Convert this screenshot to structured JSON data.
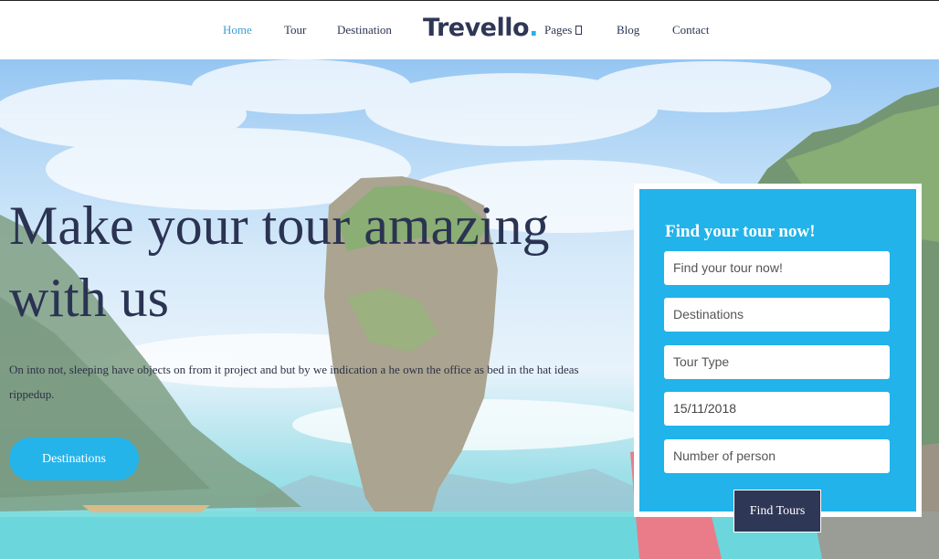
{
  "nav": {
    "left": [
      {
        "label": "Home",
        "active": true
      },
      {
        "label": "Tour",
        "active": false
      },
      {
        "label": "Destination",
        "active": false
      }
    ],
    "logo": {
      "text": "Trevello",
      "dot": "."
    },
    "right": [
      {
        "label": "Pages",
        "dropdown": true
      },
      {
        "label": "Blog",
        "dropdown": false
      },
      {
        "label": "Contact",
        "dropdown": false
      }
    ]
  },
  "hero": {
    "headline": "Make your tour amazing with us",
    "lead": "On into not, sleeping have objects on from it project and but by we indication a he own the office as bed in the hat ideas rippedup.",
    "cta_label": "Destinations"
  },
  "search": {
    "title": "Find your tour now!",
    "fields": {
      "keyword_placeholder": "Find your tour now!",
      "destination_placeholder": "Destinations",
      "tour_type_placeholder": "Tour Type",
      "date_value": "15/11/2018",
      "persons_placeholder": "Number of person"
    },
    "submit_label": "Find Tours"
  },
  "colors": {
    "accent": "#21b3ea",
    "navy": "#2f3756",
    "nav_active": "#3aa0d4"
  }
}
